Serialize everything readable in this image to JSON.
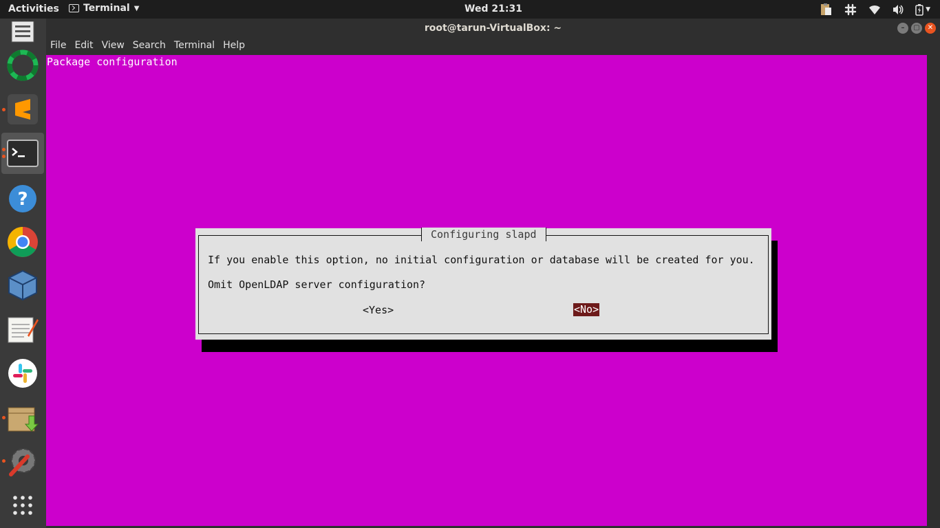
{
  "topbar": {
    "activities": "Activities",
    "app_name": "Terminal",
    "clock": "Wed 21:31"
  },
  "window": {
    "title": "root@tarun-VirtualBox: ~",
    "menu": [
      "File",
      "Edit",
      "View",
      "Search",
      "Terminal",
      "Help"
    ]
  },
  "terminal": {
    "backtitle": "Package configuration",
    "dialog": {
      "title": "Configuring slapd",
      "message": "If you enable this option, no initial configuration or database will be created for you.",
      "question": "Omit OpenLDAP server configuration?",
      "yes_label": "<Yes>",
      "no_label": "<No>",
      "selected": "no"
    }
  },
  "dock": {
    "items": [
      {
        "name": "files-cabinet-icon",
        "running": false
      },
      {
        "name": "screencast-ring-icon",
        "running": false
      },
      {
        "name": "sublime-text-icon",
        "running": true
      },
      {
        "name": "terminal-icon",
        "running": true,
        "active": true
      },
      {
        "name": "help-icon",
        "running": false
      },
      {
        "name": "chrome-icon",
        "running": false
      },
      {
        "name": "virtualbox-icon",
        "running": false
      },
      {
        "name": "text-editor-icon",
        "running": false
      },
      {
        "name": "slack-icon",
        "running": false
      },
      {
        "name": "software-install-icon",
        "running": true
      },
      {
        "name": "settings-tools-icon",
        "running": true
      },
      {
        "name": "show-apps-grid-icon",
        "running": false
      }
    ]
  },
  "colors": {
    "terminal_bg": "#cc00cc",
    "dialog_bg": "#e1e1e1",
    "selected_button_bg": "#6d1a1a",
    "accent": "#e95420"
  }
}
